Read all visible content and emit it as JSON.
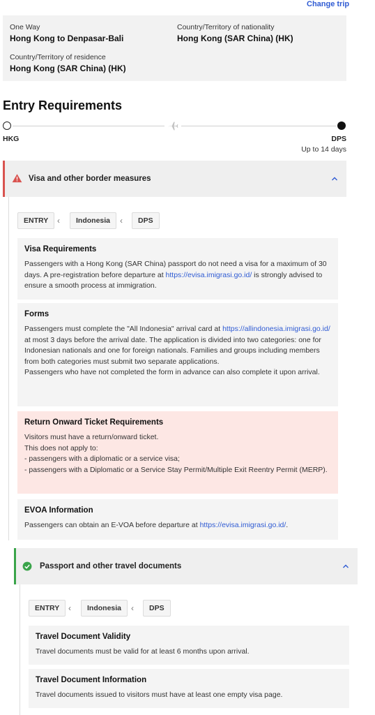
{
  "header": {
    "change_trip": "Change trip"
  },
  "trip": {
    "trip_type_label": "One Way",
    "route_value": "Hong Kong to Denpasar-Bali",
    "nationality_label": "Country/Territory of nationality",
    "nationality_value": "Hong Kong (SAR China) (HK)",
    "residence_label": "Country/Territory of residence",
    "residence_value": "Hong Kong (SAR China) (HK)"
  },
  "entry": {
    "title": "Entry Requirements",
    "origin_code": "HKG",
    "dest_code": "DPS",
    "duration": "Up to 14 days"
  },
  "sections": [
    {
      "title": "Visa and other border measures",
      "status": "warning",
      "breadcrumbs": [
        "ENTRY",
        "Indonesia",
        "DPS"
      ],
      "cards": [
        {
          "title": "Visa Requirements",
          "text_before": "Passengers with a Hong Kong (SAR China) passport do not need a visa for a maximum of 30 days. A pre-registration before departure at ",
          "link": "https://evisa.imigrasi.go.id/",
          "text_after": " is strongly advised to ensure a smooth process at immigration."
        },
        {
          "title": "Forms",
          "text_before": "Passengers must complete the \"All Indonesia\" arrival card at ",
          "link": "https://allindonesia.imigrasi.go.id/",
          "text_after": " at most 3 days before the arrival date. The application is divided into two categories: one for Indonesian nationals and one for foreign nationals. Families and groups including members from both categories must submit two separate applications.",
          "text_extra": "Passengers who have not completed the form in advance can also complete it upon arrival."
        },
        {
          "title": "Return Onward Ticket Requirements",
          "lines": [
            "Visitors must have a return/onward ticket.",
            "This does not apply to:",
            "- passengers with a diplomatic or a service visa;",
            "- passengers with a Diplomatic or a Service Stay Permit/Multiple Exit Reentry Permit (MERP)."
          ]
        },
        {
          "title": "EVOA Information",
          "text_before": "Passengers can obtain an E-VOA before departure at ",
          "link": "https://evisa.imigrasi.go.id/",
          "text_after": "."
        }
      ]
    },
    {
      "title": "Passport and other travel documents",
      "status": "ok",
      "breadcrumbs": [
        "ENTRY",
        "Indonesia",
        "DPS"
      ],
      "cards": [
        {
          "title": "Travel Document Validity",
          "text": "Travel documents must be valid for at least 6 months upon arrival."
        },
        {
          "title": "Travel Document Information",
          "text": "Travel documents issued to visitors must have at least one empty visa page."
        }
      ]
    }
  ],
  "colors": {
    "link": "#2f5bd3",
    "warning": "#d9534f",
    "ok": "#3aa44a",
    "alert_bg": "#fde7e4"
  },
  "icons": {
    "warning": "warning-triangle-icon",
    "ok": "check-circle-icon",
    "plane": "plane-icon",
    "chevron": "chevron-up-icon",
    "breadcrumb_sep": "chevron-left-icon"
  }
}
